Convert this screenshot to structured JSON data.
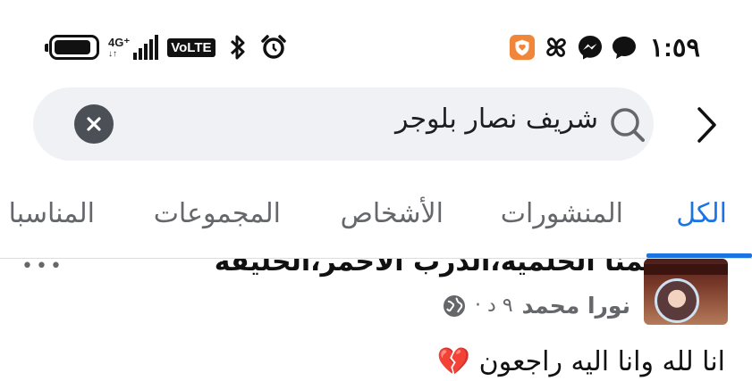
{
  "status_bar": {
    "time": "١:٥٩",
    "network_label_top": "4G⁺",
    "network_label_bottom": "↓↑",
    "volte": "VoLTE",
    "battery_level": 0.92
  },
  "search": {
    "query": "شريف نصار بلوجر"
  },
  "tabs": [
    {
      "label": "الكل",
      "active": true
    },
    {
      "label": "المنشورات",
      "active": false
    },
    {
      "label": "الأشخاص",
      "active": false
    },
    {
      "label": "المجموعات",
      "active": false
    },
    {
      "label": "المناسبا",
      "active": false
    }
  ],
  "post": {
    "title": "لمنا الحلمية،الدرب الأحمر،الخليفة",
    "author": "نورا محمد",
    "meta": "٩ د ·",
    "body": "انا لله وانا اليه راجعون 💔"
  },
  "colors": {
    "accent": "#1b74e4",
    "search_bg": "#eff1f4",
    "secondary_text": "#65676b"
  },
  "icons": {
    "status_right": [
      "shield-heart-icon",
      "pinwheel-icon",
      "messenger-icon",
      "chat-bubble-icon"
    ],
    "status_left": [
      "battery-icon",
      "signal-icon",
      "volte-icon",
      "bluetooth-icon",
      "alarm-icon"
    ]
  }
}
